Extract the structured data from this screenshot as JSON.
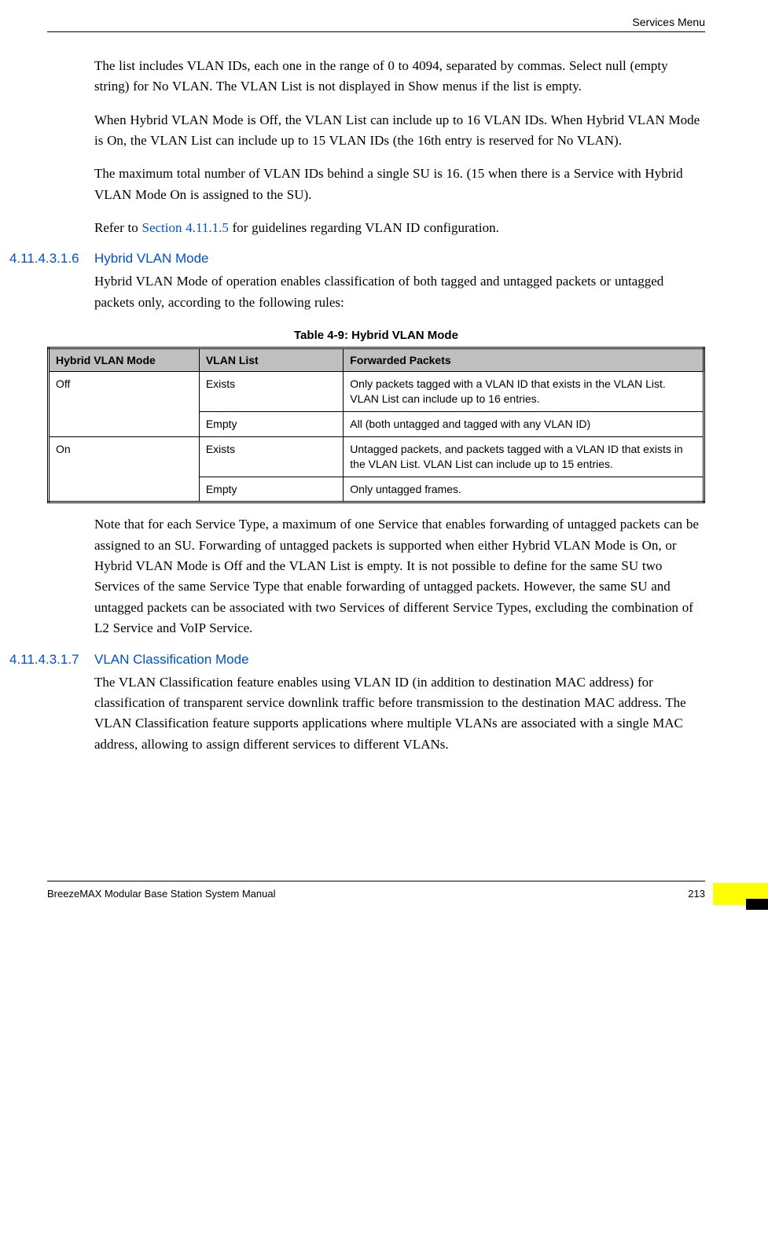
{
  "header": {
    "section": "Services Menu"
  },
  "paragraphs": {
    "p1": "The list includes VLAN IDs, each one in the range of 0 to 4094, separated by commas. Select null (empty string) for No VLAN. The VLAN List is not displayed in Show menus if the list is empty.",
    "p2": "When Hybrid VLAN Mode is Off, the VLAN List can include up to 16 VLAN IDs. When Hybrid VLAN Mode is On, the VLAN List can include up to 15 VLAN IDs (the 16th entry is reserved for No VLAN).",
    "p3": "The maximum total number of VLAN IDs behind a single SU is 16. (15 when there is a Service with Hybrid VLAN Mode On is assigned to the SU).",
    "p4_prefix": "Refer to ",
    "p4_link": "Section 4.11.1.5",
    "p4_suffix": " for guidelines regarding VLAN ID configuration.",
    "p5": "Hybrid VLAN Mode of operation enables classification of both tagged and untagged packets or untagged packets only, according to the following rules:",
    "p6": "Note that for each Service Type, a maximum of one Service that enables forwarding of untagged packets can be assigned to an SU. Forwarding of untagged packets is supported when either Hybrid VLAN Mode is On, or Hybrid VLAN Mode is Off and the VLAN List is empty. It is not possible to define for the same SU two Services of the same Service Type that enable forwarding of untagged packets. However, the same SU and untagged packets can be associated with two Services of different Service Types, excluding the combination of L2 Service and VoIP Service.",
    "p7": "The VLAN Classification feature enables using VLAN ID (in addition to destination MAC address) for classification of transparent service downlink traffic before transmission to the destination MAC address. The VLAN Classification feature supports applications where multiple VLANs are associated with a single MAC address, allowing to assign different services to different VLANs."
  },
  "sections": {
    "s1_num": "4.11.4.3.1.6",
    "s1_title": "Hybrid VLAN Mode",
    "s2_num": "4.11.4.3.1.7",
    "s2_title": "VLAN Classification Mode"
  },
  "table": {
    "caption": "Table 4-9: Hybrid VLAN Mode",
    "headers": {
      "c1": "Hybrid VLAN Mode",
      "c2": "VLAN List",
      "c3": "Forwarded Packets"
    },
    "rows": {
      "r1": {
        "mode": "Off",
        "list": "Exists",
        "packets": "Only packets tagged with a VLAN ID that exists in the VLAN List. VLAN List can include up to 16 entries."
      },
      "r2": {
        "list": "Empty",
        "packets": "All (both untagged and tagged with any VLAN ID)"
      },
      "r3": {
        "mode": "On",
        "list": "Exists",
        "packets": "Untagged packets, and packets tagged with a VLAN ID that exists in the VLAN List. VLAN List can include up to 15 entries."
      },
      "r4": {
        "list": "Empty",
        "packets": "Only untagged frames."
      }
    }
  },
  "footer": {
    "title": "BreezeMAX Modular Base Station System Manual",
    "page": "213"
  }
}
